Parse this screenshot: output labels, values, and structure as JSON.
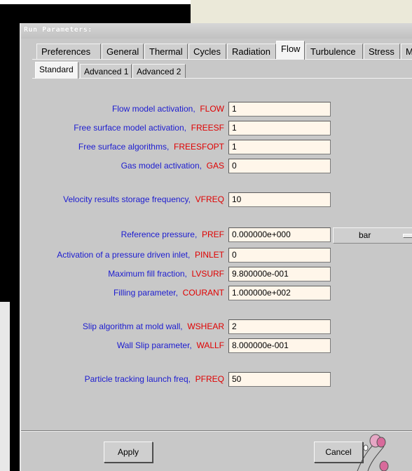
{
  "window": {
    "title": "Run Parameters:"
  },
  "tabs": [
    {
      "label": "Preferences",
      "active": false
    },
    {
      "label": "General",
      "active": false
    },
    {
      "label": "Thermal",
      "active": false
    },
    {
      "label": "Cycles",
      "active": false
    },
    {
      "label": "Radiation",
      "active": false
    },
    {
      "label": "Flow",
      "active": true
    },
    {
      "label": "Turbulence",
      "active": false
    },
    {
      "label": "Stress",
      "active": false
    },
    {
      "label": "Micro",
      "active": false
    }
  ],
  "subtabs": [
    {
      "label": "Standard",
      "active": true
    },
    {
      "label": "Advanced 1",
      "active": false
    },
    {
      "label": "Advanced 2",
      "active": false
    }
  ],
  "params": [
    {
      "label": "Flow model activation,",
      "key": "FLOW",
      "value": "1"
    },
    {
      "label": "Free surface model activation,",
      "key": "FREESF",
      "value": "1"
    },
    {
      "label": "Free surface algorithms,",
      "key": "FREESFOPT",
      "value": "1"
    },
    {
      "label": "Gas model activation,",
      "key": "GAS",
      "value": "0"
    },
    {
      "label": "Velocity results storage frequency,",
      "key": "VFREQ",
      "value": "10"
    },
    {
      "label": "Reference pressure,",
      "key": "PREF",
      "value": "0.000000e+000",
      "unit": "bar"
    },
    {
      "label": "Activation of a pressure driven inlet,",
      "key": "PINLET",
      "value": "0"
    },
    {
      "label": "Maximum fill fraction,",
      "key": "LVSURF",
      "value": "9.800000e-001"
    },
    {
      "label": "Filling parameter,",
      "key": "COURANT",
      "value": "1.000000e+002"
    },
    {
      "label": "Slip algorithm at mold wall,",
      "key": "WSHEAR",
      "value": "2"
    },
    {
      "label": "Wall Slip parameter,",
      "key": "WALLF",
      "value": "8.000000e-001"
    },
    {
      "label": "Particle tracking launch freq,",
      "key": "PFREQ",
      "value": "50"
    }
  ],
  "buttons": {
    "apply": "Apply",
    "cancel": "Cancel"
  },
  "colors": {
    "label": "#1c1cd0",
    "key": "#e00000",
    "field_bg": "#fff6ea",
    "window_bg": "#c8c8c8"
  }
}
